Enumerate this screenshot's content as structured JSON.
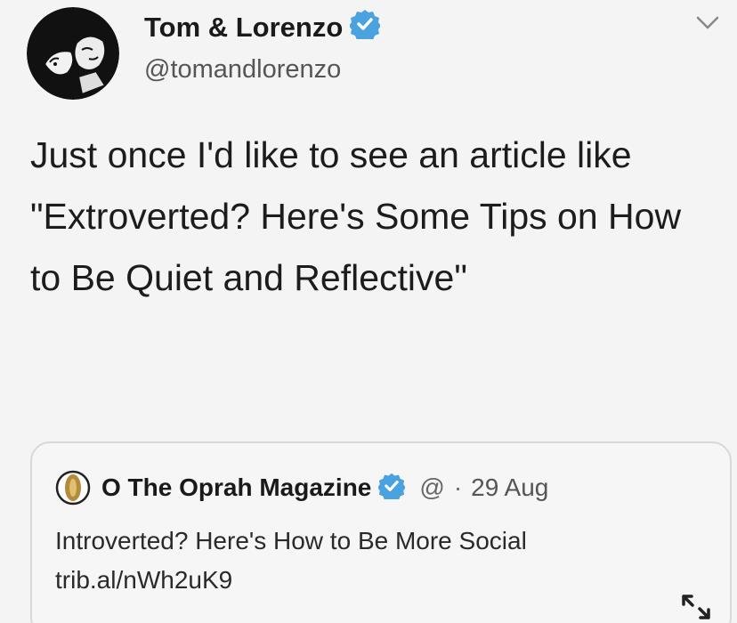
{
  "tweet": {
    "display_name": "Tom & Lorenzo",
    "handle": "@tomandlorenzo",
    "text": "Just once I'd like to see an article like \"Extroverted? Here's Some Tips on How to Be Quiet and Reflective\"",
    "verified": true
  },
  "quoted_tweet": {
    "display_name": "O The Oprah Magazine",
    "handle": "@",
    "separator": "·",
    "date": "29 Aug",
    "text": "Introverted? Here's How to Be More Social trib.al/nWh2uK9",
    "verified": true
  },
  "icons": {
    "avatar": "cartoon-avatar-icon",
    "verified": "verified-badge-icon",
    "menu": "chevron-down-icon",
    "quote_avatar": "oprah-logo-icon",
    "expand": "expand-arrows-icon"
  },
  "colors": {
    "background": "#f4f4f4",
    "verified_blue": "#4aa3df",
    "text": "#1c1c1c",
    "muted": "#666666"
  }
}
